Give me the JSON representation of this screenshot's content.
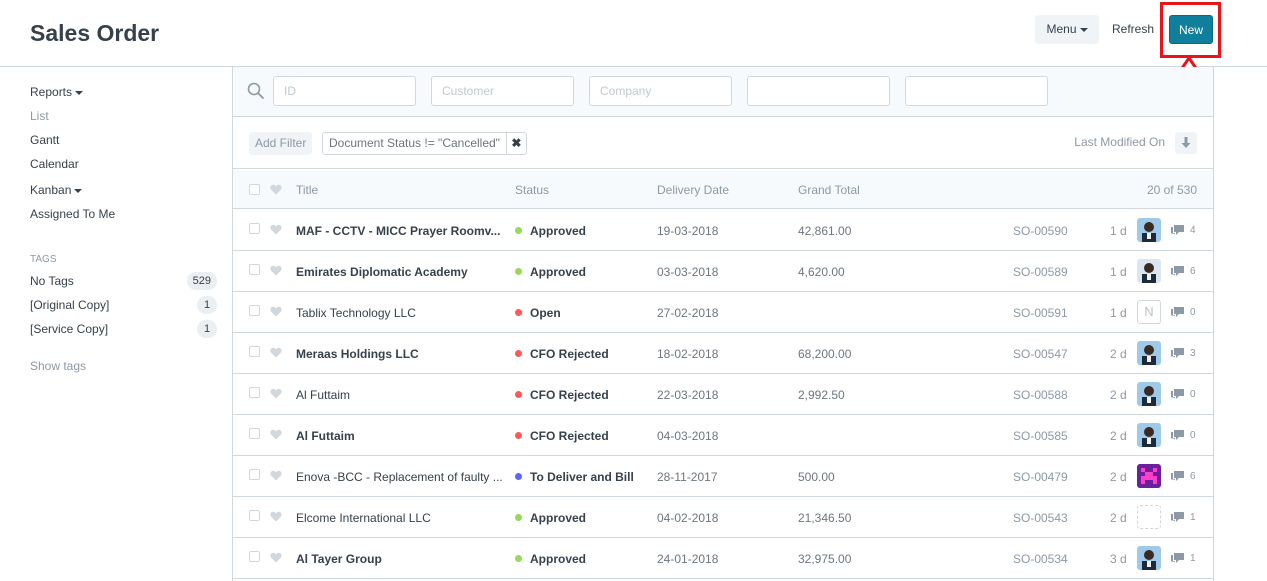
{
  "header": {
    "title": "Sales Order",
    "menu_label": "Menu",
    "refresh_label": "Refresh",
    "new_label": "New"
  },
  "sidebar": {
    "views": [
      {
        "label": "Reports",
        "dropdown": true
      },
      {
        "label": "List",
        "active": true
      },
      {
        "label": "Gantt"
      },
      {
        "label": "Calendar"
      },
      {
        "label": "Kanban",
        "dropdown": true
      },
      {
        "label": "Assigned To Me"
      }
    ],
    "tags_heading": "TAGS",
    "tags": [
      {
        "label": "No Tags",
        "count": "529"
      },
      {
        "label": "[Original Copy]",
        "count": "1"
      },
      {
        "label": "[Service Copy]",
        "count": "1"
      }
    ],
    "show_tags": "Show tags"
  },
  "filters": {
    "inputs": [
      {
        "placeholder": "ID",
        "value": ""
      },
      {
        "placeholder": "Customer",
        "value": ""
      },
      {
        "placeholder": "Company",
        "value": ""
      },
      {
        "placeholder": "",
        "value": ""
      },
      {
        "placeholder": "",
        "value": ""
      }
    ],
    "add_filter": "Add Filter",
    "active_filter": "Document Status != \"Cancelled\"",
    "sort_label": "Last Modified On"
  },
  "list": {
    "columns": {
      "title": "Title",
      "status": "Status",
      "delivery_date": "Delivery Date",
      "grand_total": "Grand Total",
      "count": "20 of 530"
    },
    "status_colors": {
      "green": "#98d85b",
      "red": "#ff5858",
      "blue": "#5e64ff"
    },
    "rows": [
      {
        "title": "MAF - CCTV - MICC Prayer Roomv...",
        "bold": true,
        "status": "Approved",
        "status_color": "green",
        "delivery_date": "19-03-2018",
        "grand_total": "42,861.00",
        "id": "SO-00590",
        "modified": "1 d",
        "avatar": "photo",
        "comments": "4"
      },
      {
        "title": "Emirates Diplomatic Academy",
        "bold": true,
        "status": "Approved",
        "status_color": "green",
        "delivery_date": "03-03-2018",
        "grand_total": "4,620.00",
        "id": "SO-00589",
        "modified": "1 d",
        "avatar": "photo-light",
        "comments": "6"
      },
      {
        "title": "Tablix Technology LLC",
        "bold": false,
        "status": "Open",
        "status_color": "red",
        "delivery_date": "27-02-2018",
        "grand_total": "",
        "id": "SO-00591",
        "modified": "1 d",
        "avatar": "letter",
        "avatar_letter": "N",
        "comments": "0"
      },
      {
        "title": "Meraas Holdings LLC",
        "bold": true,
        "status": "CFO Rejected",
        "status_color": "red",
        "delivery_date": "18-02-2018",
        "grand_total": "68,200.00",
        "id": "SO-00547",
        "modified": "2 d",
        "avatar": "photo",
        "comments": "3"
      },
      {
        "title": "Al Futtaim",
        "bold": false,
        "status": "CFO Rejected",
        "status_color": "red",
        "delivery_date": "22-03-2018",
        "grand_total": "2,992.50",
        "id": "SO-00588",
        "modified": "2 d",
        "avatar": "photo",
        "comments": "0"
      },
      {
        "title": "Al Futtaim",
        "bold": true,
        "status": "CFO Rejected",
        "status_color": "red",
        "delivery_date": "04-03-2018",
        "grand_total": "",
        "id": "SO-00585",
        "modified": "2 d",
        "avatar": "photo",
        "comments": "0"
      },
      {
        "title": "Enova -BCC - Replacement of faulty ...",
        "bold": false,
        "status": "To Deliver and Bill",
        "status_color": "blue",
        "delivery_date": "28-11-2017",
        "grand_total": "500.00",
        "id": "SO-00479",
        "modified": "2 d",
        "avatar": "pixel",
        "comments": "6"
      },
      {
        "title": "Elcome International LLC",
        "bold": false,
        "status": "Approved",
        "status_color": "green",
        "delivery_date": "04-02-2018",
        "grand_total": "21,346.50",
        "id": "SO-00543",
        "modified": "2 d",
        "avatar": "empty",
        "comments": "1"
      },
      {
        "title": "Al Tayer Group",
        "bold": true,
        "status": "Approved",
        "status_color": "green",
        "delivery_date": "24-01-2018",
        "grand_total": "32,975.00",
        "id": "SO-00534",
        "modified": "3 d",
        "avatar": "photo",
        "comments": "1"
      }
    ]
  },
  "annotation": {
    "color": "#e8141b"
  }
}
